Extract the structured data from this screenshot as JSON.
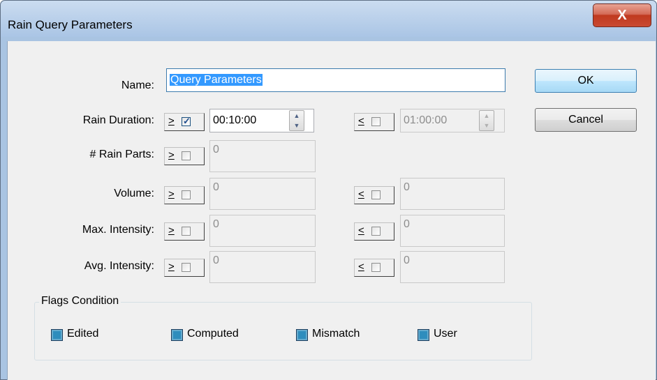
{
  "window": {
    "title": "Rain Query Parameters",
    "close_glyph": "X"
  },
  "buttons": {
    "ok": "OK",
    "cancel": "Cancel"
  },
  "toggle_glyphs": {
    "greater": ">",
    "less": "<",
    "check": "✓"
  },
  "spin_glyphs": {
    "up": "▲",
    "down": "▼"
  },
  "fields": {
    "name": {
      "label": "Name:",
      "value": "Query Parameters"
    },
    "rain_duration": {
      "label": "Rain Duration:",
      "min_enabled": true,
      "min_value": "00:10:00",
      "max_enabled": false,
      "max_value": "01:00:00"
    },
    "rain_parts": {
      "label": "# Rain Parts:",
      "min_enabled": false,
      "min_value": "0"
    },
    "volume": {
      "label": "Volume:",
      "min_enabled": false,
      "min_value": "0",
      "max_enabled": false,
      "max_value": "0"
    },
    "max_intensity": {
      "label": "Max. Intensity:",
      "min_enabled": false,
      "min_value": "0",
      "max_enabled": false,
      "max_value": "0"
    },
    "avg_intensity": {
      "label": "Avg. Intensity:",
      "min_enabled": false,
      "min_value": "0",
      "max_enabled": false,
      "max_value": "0"
    }
  },
  "flags": {
    "title": "Flags Condition",
    "items": [
      "Edited",
      "Computed",
      "Mismatch",
      "User"
    ]
  }
}
